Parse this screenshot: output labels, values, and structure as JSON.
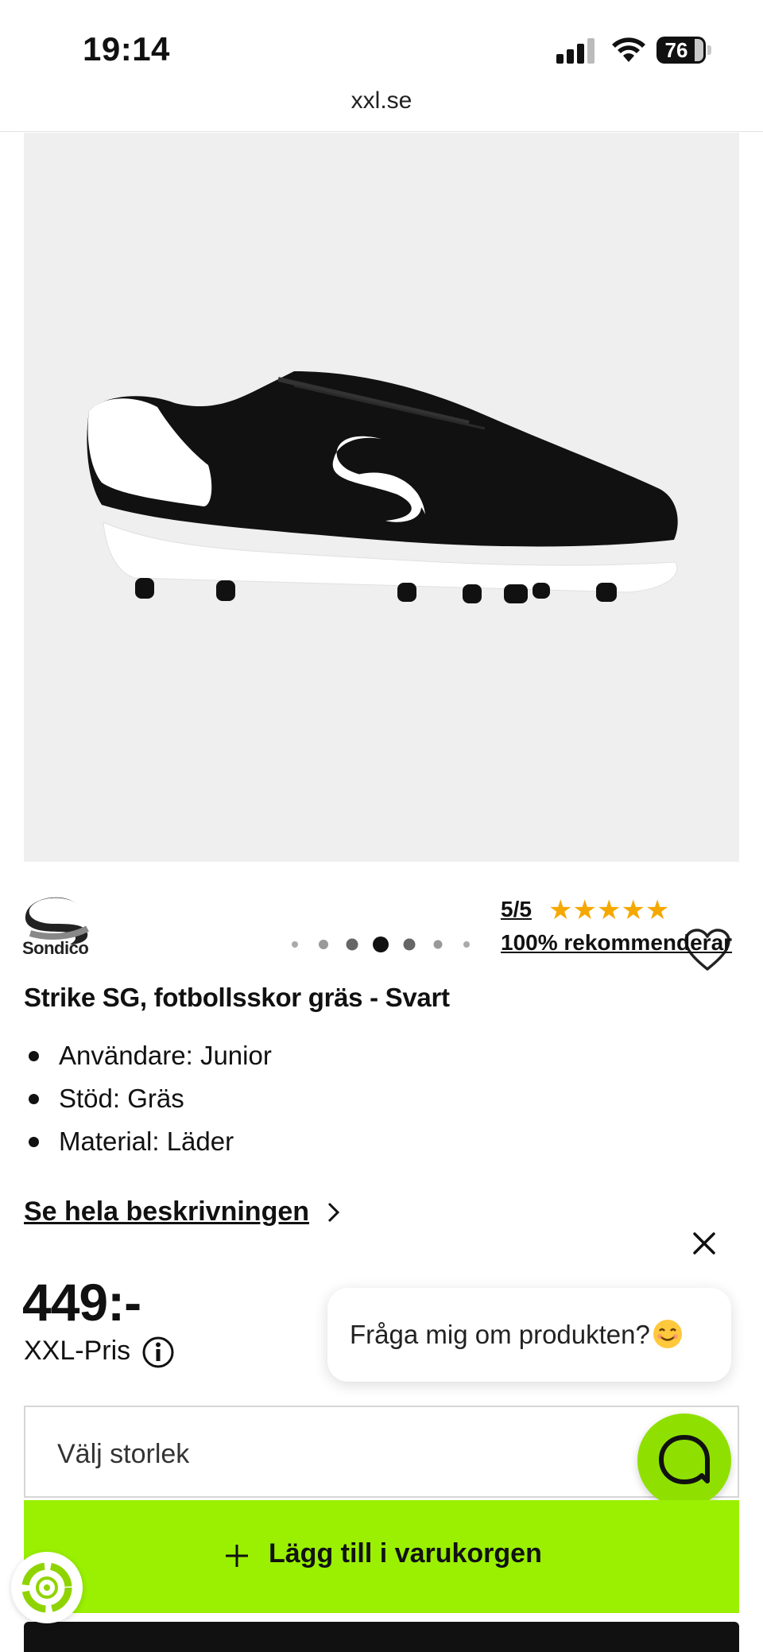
{
  "status_bar": {
    "time": "19:14",
    "battery": "76"
  },
  "browser": {
    "url": "xxl.se"
  },
  "gallery": {
    "image_count": 7,
    "active_index": 3
  },
  "brand": {
    "name": "Sondico"
  },
  "rating": {
    "score": "5/5",
    "stars": "★★★★★",
    "recommend": "100% rekommenderar"
  },
  "product": {
    "title": "Strike SG, fotbollsskor gräs - Svart",
    "features": [
      "Användare: Junior",
      "Stöd: Gräs",
      "Material: Läder"
    ],
    "see_description": "Se hela beskrivningen",
    "price": "449:-",
    "price_label": "XXL-Pris"
  },
  "chat": {
    "prompt": "Fråga mig om produkten?"
  },
  "size_selector": {
    "placeholder": "Välj storlek"
  },
  "cart": {
    "add_label": "Lägg till i varukorgen"
  },
  "colors": {
    "accent": "#9af000",
    "star": "#f5a800",
    "fab": "#8fe000"
  },
  "icons": [
    "heart-icon",
    "chevron-right-icon",
    "close-icon",
    "info-icon",
    "chat-icon",
    "plus-icon",
    "eco-icon",
    "smiley-emoji"
  ]
}
